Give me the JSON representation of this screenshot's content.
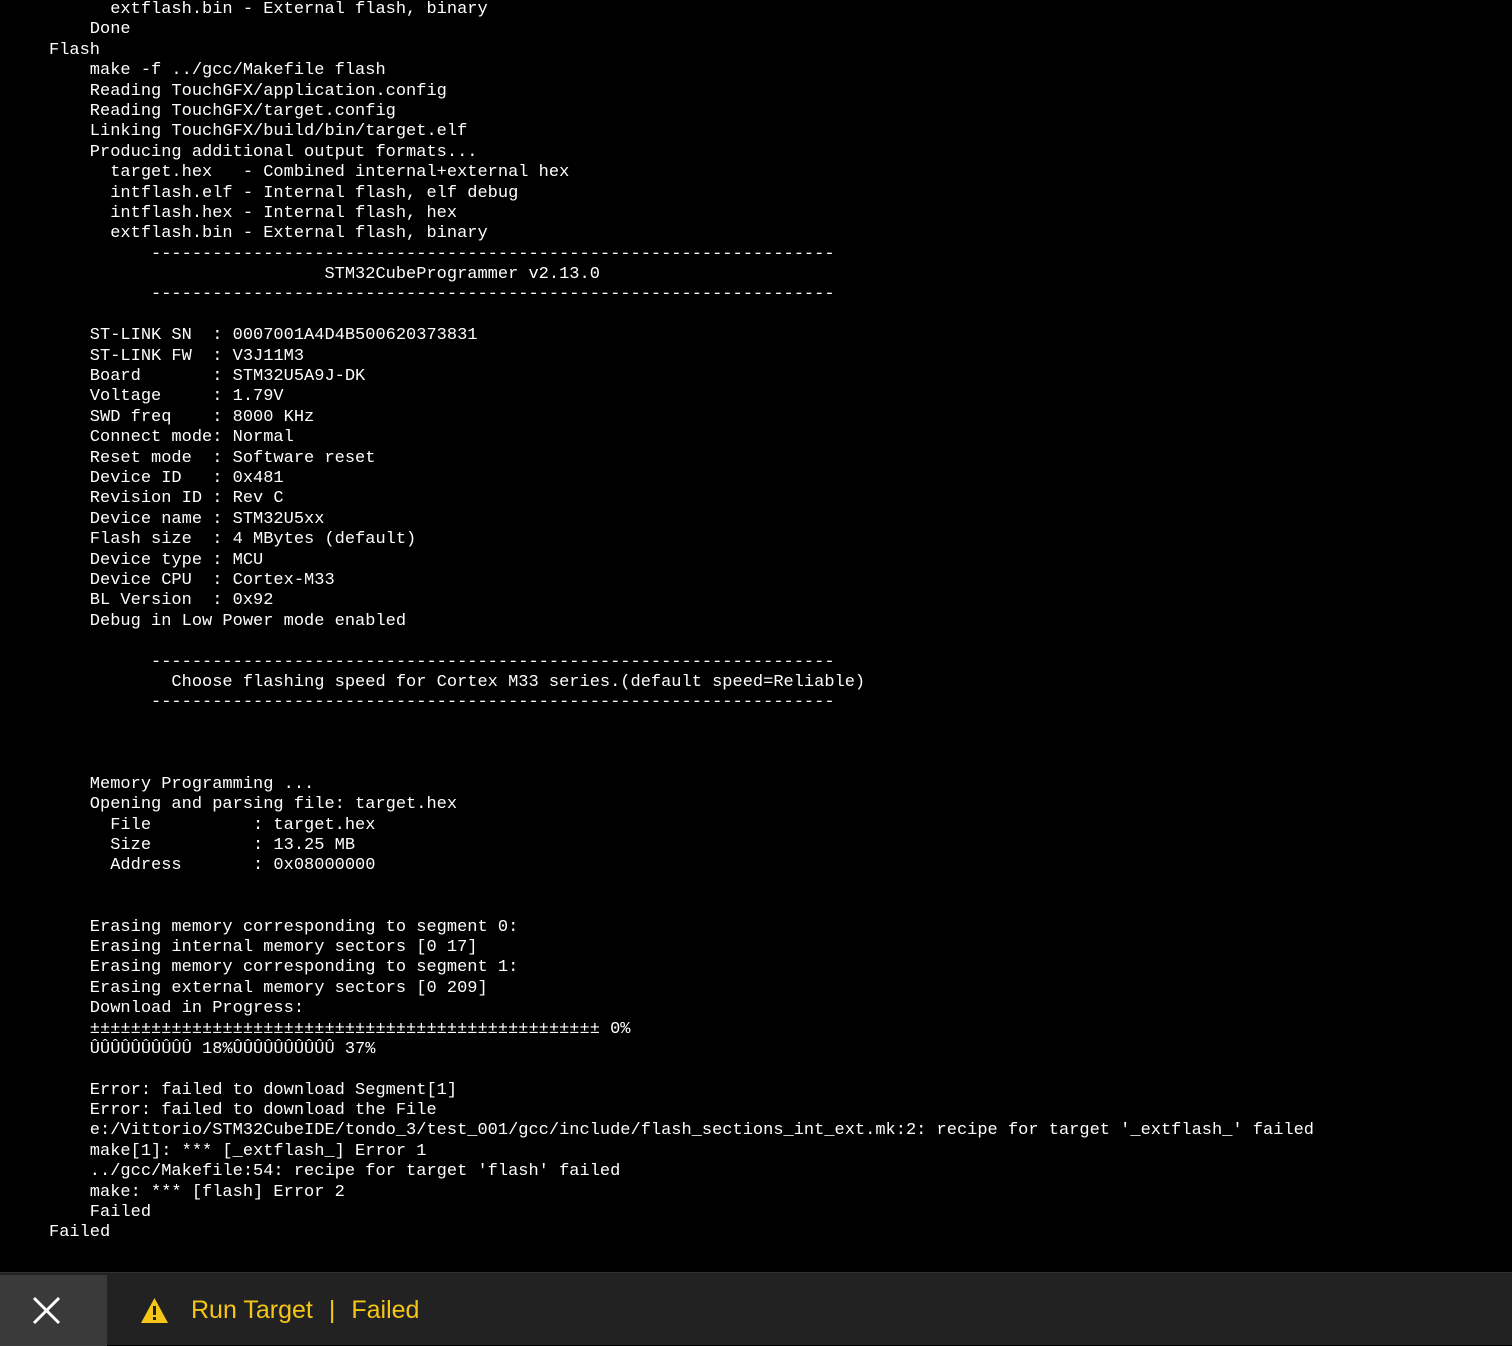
{
  "console": {
    "lines": [
      "      extflash.bin - External flash, binary",
      "    Done",
      "Flash",
      "    make -f ../gcc/Makefile flash",
      "    Reading TouchGFX/application.config",
      "    Reading TouchGFX/target.config",
      "    Linking TouchGFX/build/bin/target.elf",
      "    Producing additional output formats...",
      "      target.hex   - Combined internal+external hex",
      "      intflash.elf - Internal flash, elf debug",
      "      intflash.hex - Internal flash, hex",
      "      extflash.bin - External flash, binary",
      "          -------------------------------------------------------------------",
      "                           STM32CubeProgrammer v2.13.0",
      "          -------------------------------------------------------------------",
      "",
      "    ST-LINK SN  : 0007001A4D4B500620373831",
      "    ST-LINK FW  : V3J11M3",
      "    Board       : STM32U5A9J-DK",
      "    Voltage     : 1.79V",
      "    SWD freq    : 8000 KHz",
      "    Connect mode: Normal",
      "    Reset mode  : Software reset",
      "    Device ID   : 0x481",
      "    Revision ID : Rev C",
      "    Device name : STM32U5xx",
      "    Flash size  : 4 MBytes (default)",
      "    Device type : MCU",
      "    Device CPU  : Cortex-M33",
      "    BL Version  : 0x92",
      "    Debug in Low Power mode enabled",
      "",
      "          -------------------------------------------------------------------",
      "            Choose flashing speed for Cortex M33 series.(default speed=Reliable)",
      "          -------------------------------------------------------------------",
      "",
      "",
      "",
      "    Memory Programming ...",
      "    Opening and parsing file: target.hex",
      "      File          : target.hex",
      "      Size          : 13.25 MB",
      "      Address       : 0x08000000",
      "",
      "",
      "    Erasing memory corresponding to segment 0:",
      "    Erasing internal memory sectors [0 17]",
      "    Erasing memory corresponding to segment 1:",
      "    Erasing external memory sectors [0 209]",
      "    Download in Progress:",
      "    ±±±±±±±±±±±±±±±±±±±±±±±±±±±±±±±±±±±±±±±±±±±±±±±±±± 0%",
      "    ÛÛÛÛÛÛÛÛÛÛ 18%ÛÛÛÛÛÛÛÛÛÛ 37%",
      "",
      "    Error: failed to download Segment[1]",
      "    Error: failed to download the File",
      "    e:/Vittorio/STM32CubeIDE/tondo_3/test_001/gcc/include/flash_sections_int_ext.mk:2: recipe for target '_extflash_' failed",
      "    make[1]: *** [_extflash_] Error 1",
      "    ../gcc/Makefile:54: recipe for target 'flash' failed",
      "    make: *** [flash] Error 2",
      "    Failed",
      "Failed"
    ]
  },
  "status_bar": {
    "close_icon": "close-icon",
    "warning_icon": "warning-icon",
    "task_label": "Run Target",
    "separator": "|",
    "status_label": "Failed",
    "accent_color": "#f5c518"
  }
}
